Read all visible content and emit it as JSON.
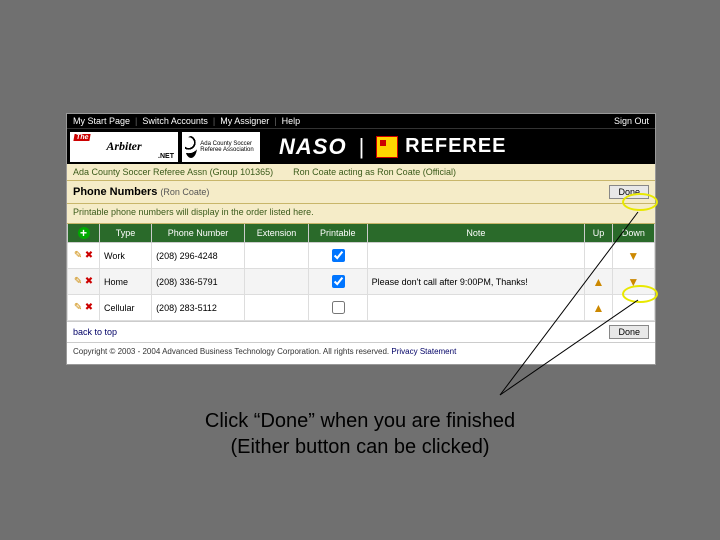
{
  "topnav": {
    "start": "My Start Page",
    "switch": "Switch Accounts",
    "assigner": "My Assigner",
    "help": "Help",
    "signout": "Sign Out"
  },
  "logos": {
    "arbiter_the": "The",
    "arbiter_main": "Arbiter",
    "arbiter_net": ".NET",
    "assoc_text": "Ada County Soccer Referee Association",
    "naso": "NASO",
    "referee": "REFEREE"
  },
  "crumb": {
    "group": "Ada County Soccer Referee Assn (Group 101365)",
    "acting": "Ron Coate acting as Ron Coate (Official)"
  },
  "section": {
    "title": "Phone Numbers",
    "user": "(Ron Coate)",
    "hint": "Printable phone numbers will display in the order listed here.",
    "done": "Done"
  },
  "table": {
    "headers": {
      "type": "Type",
      "phone": "Phone Number",
      "ext": "Extension",
      "printable": "Printable",
      "note": "Note",
      "up": "Up",
      "down": "Down"
    },
    "rows": [
      {
        "type": "Work",
        "phone": "(208) 296-4248",
        "ext": "",
        "printable": true,
        "note": "",
        "up": false,
        "down": true
      },
      {
        "type": "Home",
        "phone": "(208) 336-5791",
        "ext": "",
        "printable": true,
        "note": "Please don't call after 9:00PM, Thanks!",
        "up": true,
        "down": true
      },
      {
        "type": "Cellular",
        "phone": "(208) 283-5112",
        "ext": "",
        "printable": false,
        "note": "",
        "up": true,
        "down": false
      }
    ]
  },
  "footer": {
    "back": "back to top",
    "done": "Done",
    "copyright": "Copyright © 2003 - 2004 Advanced Business Technology Corporation. All rights reserved.",
    "privacy": "Privacy Statement"
  },
  "caption": {
    "line1": "Click “Done” when you are finished",
    "line2": "(Either button can be clicked)"
  }
}
